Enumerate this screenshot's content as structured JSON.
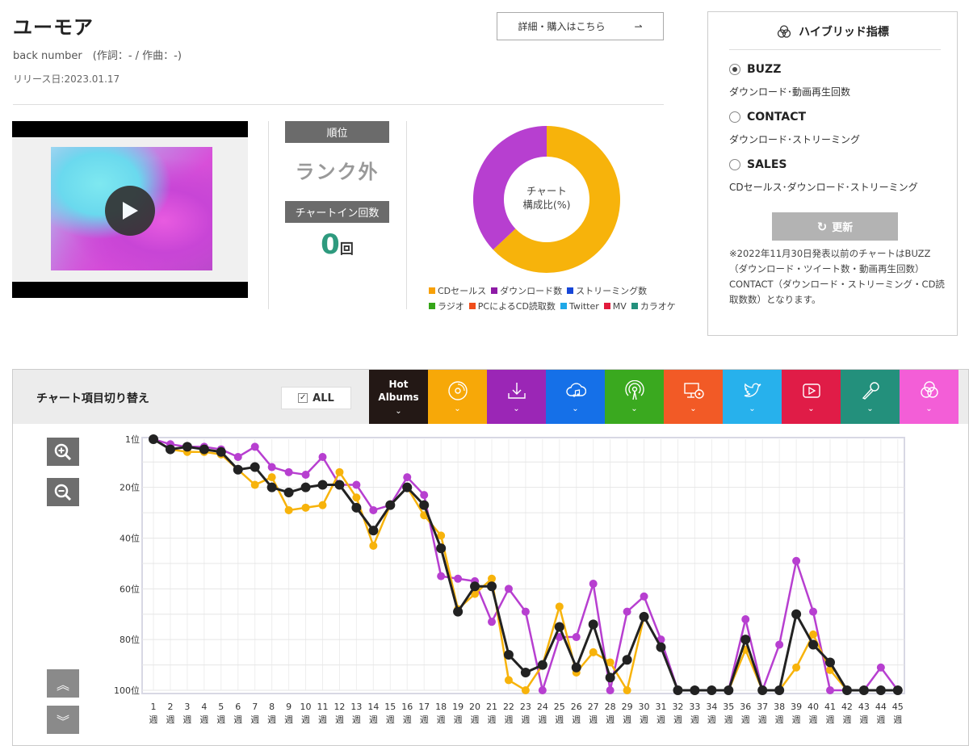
{
  "song": {
    "title": "ユーモア",
    "artist": "back number　(作詞：- / 作曲：-)",
    "release": "リリース日:2023.01.17",
    "detail_button": "詳細・購入はこちら",
    "detail_arrow": "⇀"
  },
  "stats": {
    "rank_label": "順位",
    "rank_value": "ランク外",
    "chartin_label": "チャートイン回数",
    "chartin_value": "0",
    "chartin_unit": "回"
  },
  "composition": {
    "center_line1": "チャート",
    "center_line2": "構成比(%)",
    "slices": [
      {
        "name": "CDセールス",
        "value": 63,
        "color": "#f7b30b"
      },
      {
        "name": "ダウンロード数",
        "value": 37,
        "color": "#b73fd0"
      }
    ],
    "legend": [
      {
        "label": "CDセールス",
        "color": "#f7a007"
      },
      {
        "label": "ダウンロード数",
        "color": "#8e1ba6"
      },
      {
        "label": "ストリーミング数",
        "color": "#1646d8"
      },
      {
        "label": "ラジオ",
        "color": "#35a519"
      },
      {
        "label": "PCによるCD読取数",
        "color": "#f04d1a"
      },
      {
        "label": "Twitter",
        "color": "#1ea8e8"
      },
      {
        "label": "MV",
        "color": "#e21b3c"
      },
      {
        "label": "カラオケ",
        "color": "#23907c"
      }
    ]
  },
  "hybrid": {
    "title": "ハイブリッド指標",
    "options": [
      {
        "label": "BUZZ",
        "desc": "ダウンロード･動画再生回数",
        "selected": true
      },
      {
        "label": "CONTACT",
        "desc": "ダウンロード･ストリーミング",
        "selected": false
      },
      {
        "label": "SALES",
        "desc": "CDセールス･ダウンロード･ストリーミング",
        "selected": false
      }
    ],
    "update_button": "更新",
    "note": "※2022年11月30日発表以前のチャートはBUZZ（ダウンロード・ツイート数・動画再生回数）CONTACT（ダウンロード・ストリーミング・CD読取数数）となります。"
  },
  "switcher": {
    "title": "チャート項目切り替え",
    "all_label": "ALL",
    "hot_label_1": "Hot",
    "hot_label_2": "Albums",
    "buttons": [
      {
        "icon": "cd-icon",
        "color": "#f7a808"
      },
      {
        "icon": "download-icon",
        "color": "#9b26b6"
      },
      {
        "icon": "streaming-icon",
        "color": "#1570e8"
      },
      {
        "icon": "radio-icon",
        "color": "#3aa91f"
      },
      {
        "icon": "pc-cd-icon",
        "color": "#f25a26"
      },
      {
        "icon": "twitter-icon",
        "color": "#27b1ec"
      },
      {
        "icon": "mv-icon",
        "color": "#e01c47"
      },
      {
        "icon": "karaoke-icon",
        "color": "#23907c"
      },
      {
        "icon": "hybrid-icon",
        "color": "#f35ed7"
      }
    ]
  },
  "chart_data": {
    "type": "line",
    "y_reversed": true,
    "ylim": [
      1,
      100
    ],
    "y_ticks": [
      "1位",
      "20位",
      "40位",
      "60位",
      "80位",
      "100位"
    ],
    "y_tick_values": [
      1,
      20,
      40,
      60,
      80,
      100
    ],
    "x": [
      1,
      2,
      3,
      4,
      5,
      6,
      7,
      8,
      9,
      10,
      11,
      12,
      13,
      14,
      15,
      16,
      17,
      18,
      19,
      20,
      21,
      22,
      23,
      24,
      25,
      26,
      27,
      28,
      29,
      30,
      31,
      32,
      33,
      34,
      35,
      36,
      37,
      38,
      39,
      40,
      41,
      42,
      43,
      44,
      45
    ],
    "x_unit": "週",
    "grid": true,
    "series": [
      {
        "color": "#b73fd0",
        "values": [
          1,
          3,
          4,
          4,
          5,
          8,
          4,
          12,
          14,
          15,
          8,
          19,
          19,
          29,
          27,
          16,
          23,
          55,
          56,
          57,
          73,
          60,
          69,
          100,
          79,
          79,
          58,
          100,
          69,
          63,
          80,
          100,
          100,
          100,
          100,
          72,
          100,
          82,
          49,
          69,
          100,
          100,
          100,
          91,
          100
        ]
      },
      {
        "color": "#f7b30b",
        "values": [
          1,
          5,
          6,
          6,
          7,
          13,
          19,
          16,
          29,
          28,
          27,
          14,
          24,
          43,
          27,
          20,
          31,
          39,
          68,
          62,
          56,
          96,
          100,
          90,
          67,
          93,
          85,
          89,
          100,
          71,
          83,
          100,
          100,
          100,
          100,
          84,
          100,
          100,
          91,
          78,
          92,
          100,
          100,
          100,
          100
        ]
      },
      {
        "color": "#222222",
        "values": [
          1,
          5,
          4,
          5,
          6,
          13,
          12,
          20,
          22,
          20,
          19,
          19,
          28,
          37,
          27,
          20,
          27,
          44,
          69,
          59,
          59,
          86,
          93,
          90,
          75,
          91,
          74,
          95,
          88,
          71,
          83,
          100,
          100,
          100,
          100,
          80,
          100,
          100,
          70,
          82,
          89,
          100,
          100,
          100,
          100
        ]
      }
    ]
  }
}
